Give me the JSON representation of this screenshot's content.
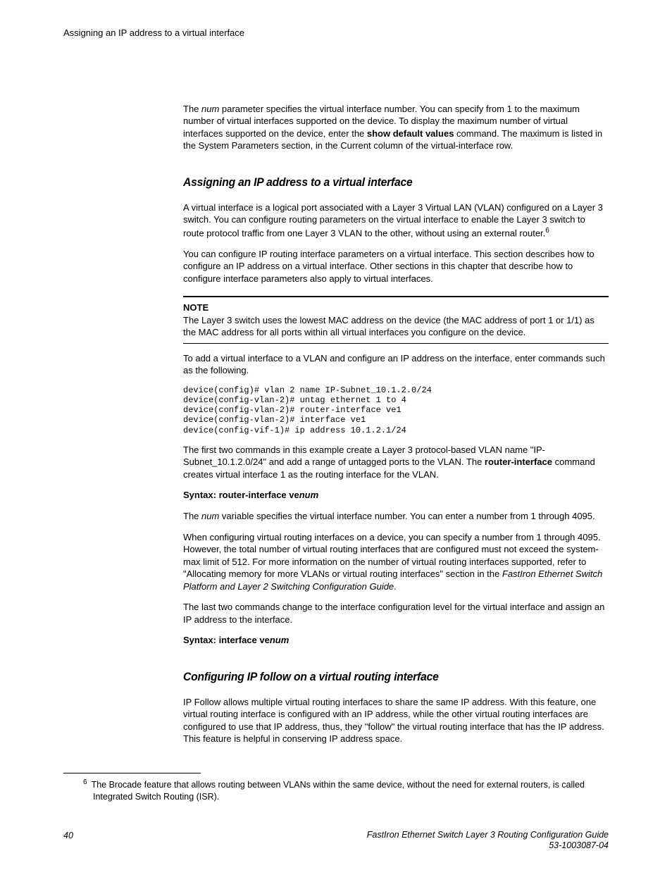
{
  "running_head": "Assigning an IP address to a virtual interface",
  "intro": {
    "p1a": "The ",
    "p1b_italic": "num",
    "p1c": " parameter specifies the virtual interface number. You can specify from 1 to the maximum number of virtual interfaces supported on the device. To display the maximum number of virtual interfaces supported on the device, enter the ",
    "p1d_bold": "show default values",
    "p1e": " command. The maximum is listed in the System Parameters section, in the Current column of the virtual-interface row."
  },
  "sec1": {
    "title": "Assigning an IP address to a virtual interface",
    "p1": "A virtual interface is a logical port associated with a Layer 3 Virtual LAN (VLAN) configured on a Layer 3 switch. You can configure routing parameters on the virtual interface to enable the Layer 3 switch to route protocol traffic from one Layer 3 VLAN to the other, without using an external router.",
    "fnref": "6",
    "p2": "You can configure IP routing interface parameters on a virtual interface. This section describes how to configure an IP address on a virtual interface. Other sections in this chapter that describe how to configure interface parameters also apply to virtual interfaces.",
    "note_label": "NOTE",
    "note_body": "The Layer 3 switch uses the lowest MAC address on the device (the MAC address of port 1 or 1/1) as the MAC address for all ports within all virtual interfaces you configure on the device.",
    "p3": "To add a virtual interface to a VLAN and configure an IP address on the interface, enter commands such as the following.",
    "code": "device(config)# vlan 2 name IP-Subnet_10.1.2.0/24\ndevice(config-vlan-2)# untag ethernet 1 to 4\ndevice(config-vlan-2)# router-interface ve1\ndevice(config-vlan-2)# interface ve1\ndevice(config-vif-1)# ip address 10.1.2.1/24",
    "p4a": "The first two commands in this example create a Layer 3 protocol-based VLAN name \"IP-Subnet_10.1.2.0/24\" and add a range of untagged ports to the VLAN. The ",
    "p4b_bold": "router-interface",
    "p4c": " command creates virtual interface 1 as the routing interface for the VLAN.",
    "syntax1a": "Syntax: router-interface ve",
    "syntax1b_italic": "num",
    "p5a": "The ",
    "p5b_italic": "num",
    "p5c": " variable specifies the virtual interface number. You can enter a number from 1 through 4095.",
    "p6a": "When configuring virtual routing interfaces on a device, you can specify a number from 1 through 4095. However, the total number of virtual routing interfaces that are configured must not exceed the system-max limit of 512. For more information on the number of virtual routing interfaces supported, refer to \"Allocating memory for more VLANs or virtual routing interfaces\" section in the ",
    "p6b_italic": "FastIron Ethernet Switch Platform and Layer 2 Switching Configuration Guide",
    "p6c": ".",
    "p7": "The last two commands change to the interface configuration level for the virtual interface and assign an IP address to the interface.",
    "syntax2a": "Syntax: interface ve",
    "syntax2b_italic": "num"
  },
  "sec2": {
    "title": "Configuring IP follow on a virtual routing interface",
    "p1": "IP Follow allows multiple virtual routing interfaces to share the same IP address. With this feature, one virtual routing interface is configured with an IP address, while the other virtual routing interfaces are configured to use that IP address, thus, they \"follow\" the virtual routing interface that has the IP address. This feature is helpful in conserving IP address space."
  },
  "footnote": {
    "marker": "6",
    "text": "The Brocade feature that allows routing between VLANs within the same device, without the need for external routers, is called Integrated Switch Routing (ISR)."
  },
  "footer": {
    "pagenum": "40",
    "guide1": "FastIron Ethernet Switch Layer 3 Routing Configuration Guide",
    "guide2": "53-1003087-04"
  }
}
